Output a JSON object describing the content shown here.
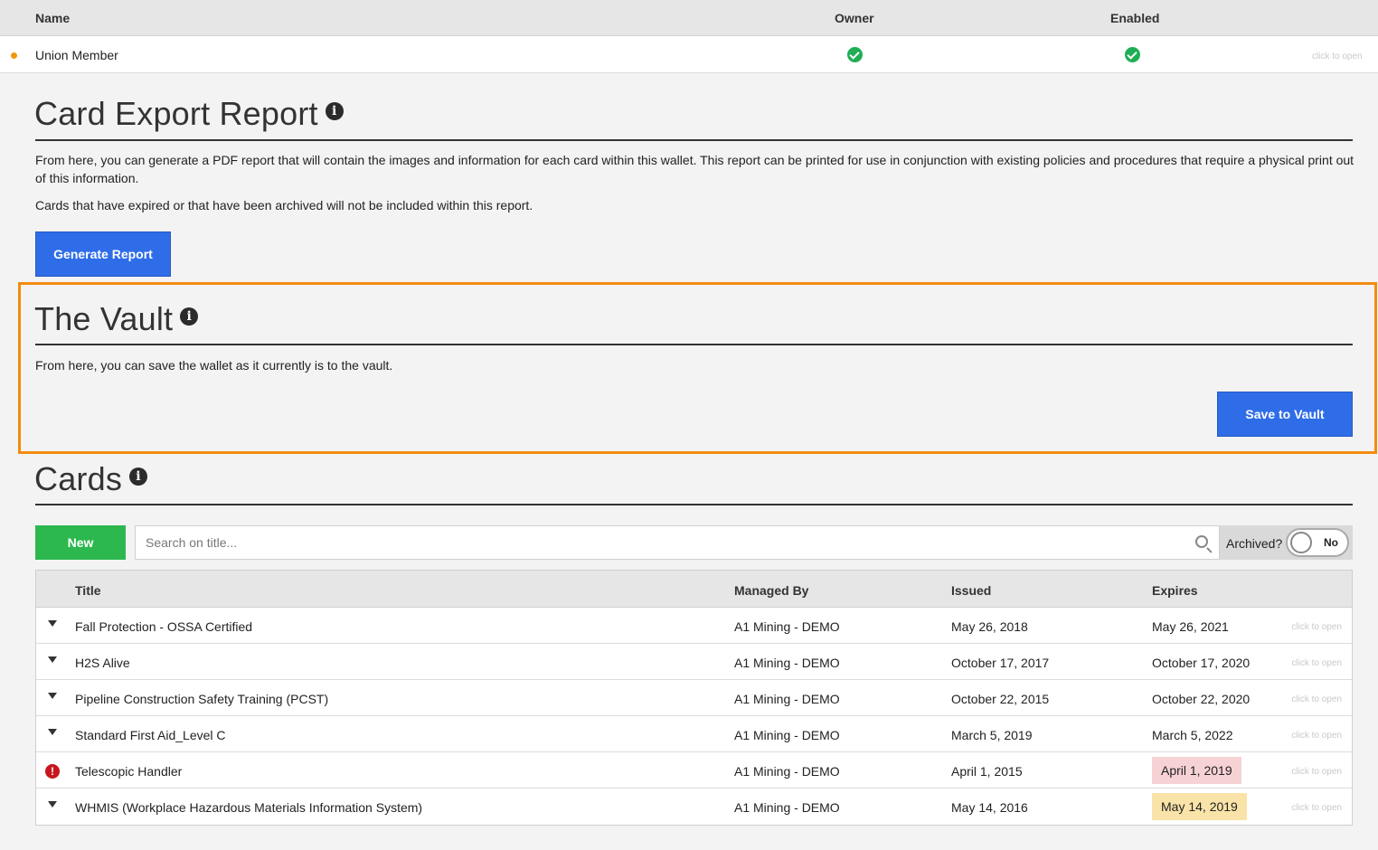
{
  "members": {
    "headers": {
      "name": "Name",
      "owner": "Owner",
      "enabled": "Enabled"
    },
    "rows": [
      {
        "name": "Union Member",
        "owner": true,
        "enabled": true,
        "status_color": "#f0960c",
        "action": "click to open"
      }
    ]
  },
  "card_export": {
    "title": "Card Export Report",
    "info_icon": "info-icon",
    "paragraph1": "From here, you can generate a PDF report that will contain the images and information for each card within this wallet. This report can be printed for use in conjunction with existing policies and procedures that require a physical print out of this information.",
    "paragraph2": "Cards that have expired or that have been archived will not be included within this report.",
    "button_label": "Generate Report"
  },
  "vault": {
    "title": "The Vault",
    "paragraph": "From here, you can save the wallet as it currently is to the vault.",
    "button_label": "Save to Vault"
  },
  "cards": {
    "title": "Cards",
    "new_label": "New",
    "search_placeholder": "Search on title...",
    "archived_label": "Archived?",
    "archived_toggle": "No",
    "headers": {
      "title": "Title",
      "managed_by": "Managed By",
      "issued": "Issued",
      "expires": "Expires"
    },
    "rows": [
      {
        "title": "Fall Protection - OSSA Certified",
        "managed_by": "A1 Mining - DEMO",
        "issued": "May 26, 2018",
        "expires": "May 26, 2021",
        "status": "normal",
        "action": "click to open"
      },
      {
        "title": "H2S Alive",
        "managed_by": "A1 Mining - DEMO",
        "issued": "October 17, 2017",
        "expires": "October 17, 2020",
        "status": "normal",
        "action": "click to open"
      },
      {
        "title": "Pipeline Construction Safety Training (PCST)",
        "managed_by": "A1 Mining - DEMO",
        "issued": "October 22, 2015",
        "expires": "October 22, 2020",
        "status": "normal",
        "action": "click to open"
      },
      {
        "title": "Standard First Aid_Level C",
        "managed_by": "A1 Mining - DEMO",
        "issued": "March 5, 2019",
        "expires": "March 5, 2022",
        "status": "normal",
        "action": "click to open"
      },
      {
        "title": "Telescopic Handler",
        "managed_by": "A1 Mining - DEMO",
        "issued": "April 1, 2015",
        "expires": "April 1, 2019",
        "status": "expired",
        "action": "click to open"
      },
      {
        "title": "WHMIS (Workplace Hazardous Materials Information System)",
        "managed_by": "A1 Mining - DEMO",
        "issued": "May 14, 2016",
        "expires": "May 14, 2019",
        "status": "expiring",
        "action": "click to open"
      }
    ]
  },
  "colors": {
    "primary_button": "#2f6de8",
    "new_button": "#2db84f",
    "highlight": "#f28c0f",
    "expired_bg": "#f7d2d4",
    "expiring_bg": "#fae3a8",
    "check": "#1fae55"
  }
}
